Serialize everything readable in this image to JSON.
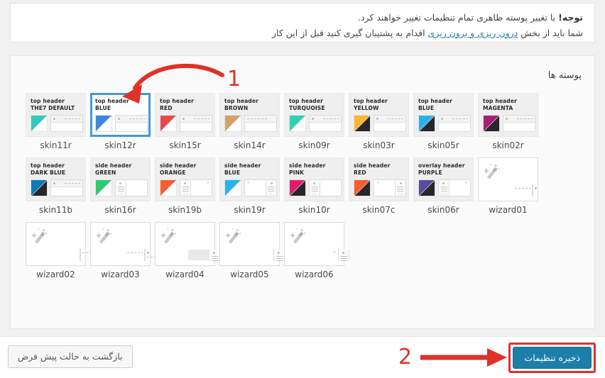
{
  "notice": {
    "strong": "توجه!",
    "line1_rest": " با تغییر پوسته ظاهری تمام تنظیمات تغییر خواهند کرد.",
    "line2_a": "شما باید از بخش ",
    "line2_link": "درون ریزی و برون ریزی",
    "line2_b": " اقدام به پشتیبان گیری کنید قبل از این کار"
  },
  "panel": {
    "title": "پوسته ها"
  },
  "annotations": {
    "step1": "1",
    "step2": "2",
    "accent": "#e03127"
  },
  "colors": {
    "selected_border": "#3e9bd9",
    "save_button": "#1b7fa9",
    "link": "#2a7fa5"
  },
  "footer": {
    "reset_label": "بازگشت به حالت پیش فرض",
    "save_label": "ذخیره تنظیمات"
  },
  "skins": [
    [
      {
        "id": "skin11r",
        "line1": "top header",
        "line2": "THE7 DEFAULT",
        "color": "#2ed3ae",
        "color2": "#3fb8e0",
        "dark": false,
        "selected": false,
        "type": "top",
        "mini": "top-a"
      },
      {
        "id": "skin12r",
        "line1": "top header",
        "line2": "BLUE",
        "color": "#3e86e0",
        "color2": "#3e86e0",
        "dark": false,
        "selected": true,
        "type": "top",
        "mini": "top-a"
      },
      {
        "id": "skin15r",
        "line1": "top header",
        "line2": "RED",
        "color": "#e8474c",
        "color2": "#e8474c",
        "dark": false,
        "selected": false,
        "type": "top",
        "mini": "top-b"
      },
      {
        "id": "skin14r",
        "line1": "top header",
        "line2": "BROWN",
        "color": "#d4a266",
        "color2": "#d4a266",
        "dark": false,
        "selected": false,
        "type": "top",
        "mini": "top-c"
      },
      {
        "id": "skin09r",
        "line1": "top header",
        "line2": "TURQUOISE",
        "color": "#2ed3ae",
        "color2": "#2ed3ae",
        "dark": false,
        "selected": false,
        "type": "top",
        "mini": "top-d"
      },
      {
        "id": "skin03r",
        "line1": "top header",
        "line2": "YELLOW",
        "color": "#fdb62b",
        "color2": "#fdb62b",
        "dark": true,
        "selected": false,
        "type": "top",
        "mini": "top-a"
      },
      {
        "id": "skin05r",
        "line1": "top header",
        "line2": "BLUE",
        "color": "#29b3ee",
        "color2": "#29b3ee",
        "dark": true,
        "selected": false,
        "type": "top",
        "mini": "top-a"
      },
      {
        "id": "skin02r",
        "line1": "top header",
        "line2": "MAGENTA",
        "color": "#a81d78",
        "color2": "#a81d78",
        "dark": true,
        "selected": false,
        "type": "top",
        "mini": "top-a"
      }
    ],
    [
      {
        "id": "skin11b",
        "line1": "top header",
        "line2": "DARK BLUE",
        "color": "#0d7ab8",
        "color2": "#0d7ab8",
        "dark": true,
        "selected": false,
        "type": "top",
        "mini": "top-a"
      },
      {
        "id": "skin16r",
        "line1": "side header",
        "line2": "GREEN",
        "color": "#2ecc71",
        "color2": "#2ecc71",
        "dark": false,
        "selected": false,
        "type": "side",
        "mini": "side-left"
      },
      {
        "id": "skin19b",
        "line1": "side header",
        "line2": "ORANGE",
        "color": "#fa5c2e",
        "color2": "#fa5c2e",
        "dark": false,
        "selected": false,
        "type": "side",
        "mini": "side-left-x"
      },
      {
        "id": "skin19r",
        "line1": "side header",
        "line2": "BLUE",
        "color": "#29b3ee",
        "color2": "#29b3ee",
        "dark": false,
        "selected": false,
        "type": "side",
        "mini": "side-right"
      },
      {
        "id": "skin10r",
        "line1": "side header",
        "line2": "PINK",
        "color": "#e01d69",
        "color2": "#e01d69",
        "dark": true,
        "selected": false,
        "type": "side",
        "mini": "side-left"
      },
      {
        "id": "skin07c",
        "line1": "side header",
        "line2": "RED",
        "color": "#fa5c2e",
        "color2": "#fa5c2e",
        "dark": true,
        "selected": false,
        "type": "side",
        "mini": "side-right"
      },
      {
        "id": "skin06r",
        "line1": "overlay header",
        "line2": "PURPLE",
        "color": "#5b4b9e",
        "color2": "#5b4b9e",
        "dark": true,
        "selected": false,
        "type": "overlay",
        "mini": "side-left-x"
      },
      {
        "id": "wizard01",
        "line1": "",
        "line2": "",
        "wizard": true,
        "mini": "wiz-top-a"
      }
    ],
    [
      {
        "id": "wizard02",
        "line1": "",
        "line2": "",
        "wizard": true,
        "mini": "wiz-top-b"
      },
      {
        "id": "wizard03",
        "line1": "",
        "line2": "",
        "wizard": true,
        "mini": "wiz-top-c"
      },
      {
        "id": "wizard04",
        "line1": "",
        "line2": "",
        "wizard": true,
        "mini": "wiz-side-a"
      },
      {
        "id": "wizard05",
        "line1": "",
        "line2": "",
        "wizard": true,
        "mini": "wiz-side-b"
      },
      {
        "id": "wizard06",
        "line1": "",
        "line2": "",
        "wizard": true,
        "mini": "wiz-side-c"
      }
    ]
  ]
}
